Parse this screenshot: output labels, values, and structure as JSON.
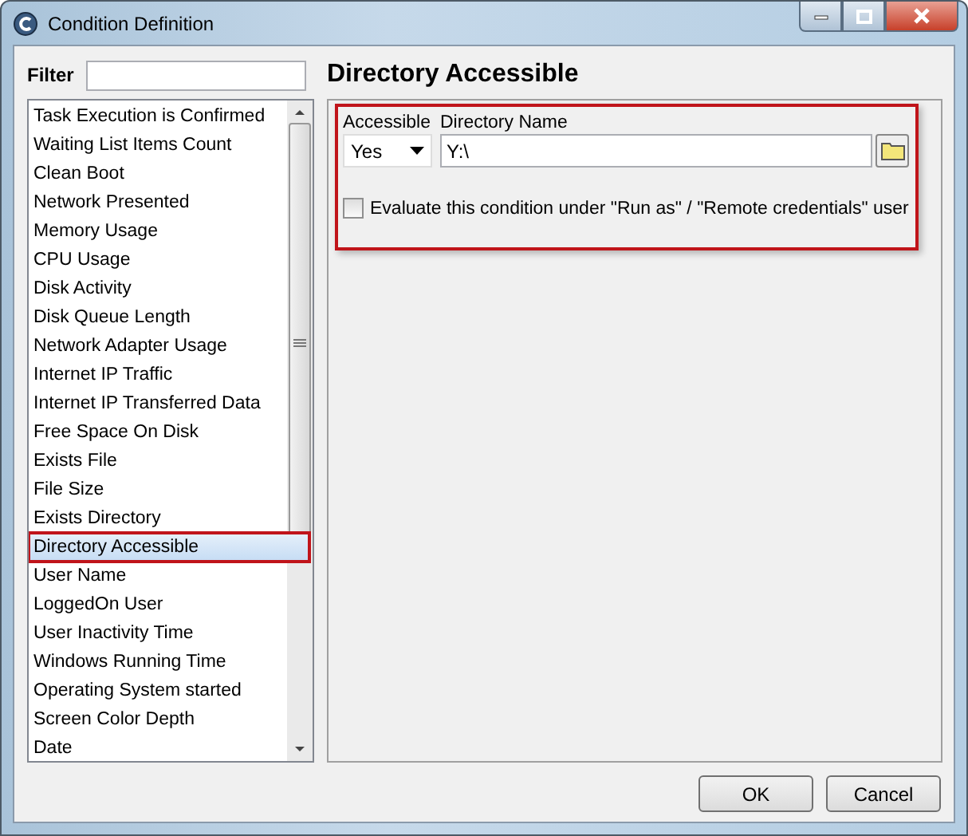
{
  "window": {
    "title": "Condition Definition"
  },
  "filter": {
    "label": "Filter"
  },
  "conditions": [
    {
      "label": "Task Execution is Confirmed",
      "selected": false
    },
    {
      "label": "Waiting List Items Count",
      "selected": false
    },
    {
      "label": "Clean Boot",
      "selected": false
    },
    {
      "label": "Network Presented",
      "selected": false
    },
    {
      "label": "Memory Usage",
      "selected": false
    },
    {
      "label": "CPU Usage",
      "selected": false
    },
    {
      "label": "Disk Activity",
      "selected": false
    },
    {
      "label": "Disk Queue Length",
      "selected": false
    },
    {
      "label": "Network Adapter Usage",
      "selected": false
    },
    {
      "label": "Internet IP Traffic",
      "selected": false
    },
    {
      "label": "Internet IP Transferred Data",
      "selected": false
    },
    {
      "label": "Free Space On Disk",
      "selected": false
    },
    {
      "label": "Exists File",
      "selected": false
    },
    {
      "label": "File Size",
      "selected": false
    },
    {
      "label": "Exists Directory",
      "selected": false
    },
    {
      "label": "Directory Accessible",
      "selected": true
    },
    {
      "label": "User Name",
      "selected": false
    },
    {
      "label": "LoggedOn User",
      "selected": false
    },
    {
      "label": "User Inactivity Time",
      "selected": false
    },
    {
      "label": "Windows Running Time",
      "selected": false
    },
    {
      "label": "Operating System started",
      "selected": false
    },
    {
      "label": "Screen Color Depth",
      "selected": false
    },
    {
      "label": "Date",
      "selected": false
    }
  ],
  "panel": {
    "title": "Directory Accessible",
    "accessible": {
      "label": "Accessible",
      "value": "Yes"
    },
    "directory": {
      "label": "Directory Name",
      "value": "Y:\\"
    },
    "run_as": {
      "label": "Evaluate this condition under \"Run as\" / \"Remote credentials\" user",
      "checked": false
    }
  },
  "buttons": [
    "OK",
    "Cancel"
  ]
}
